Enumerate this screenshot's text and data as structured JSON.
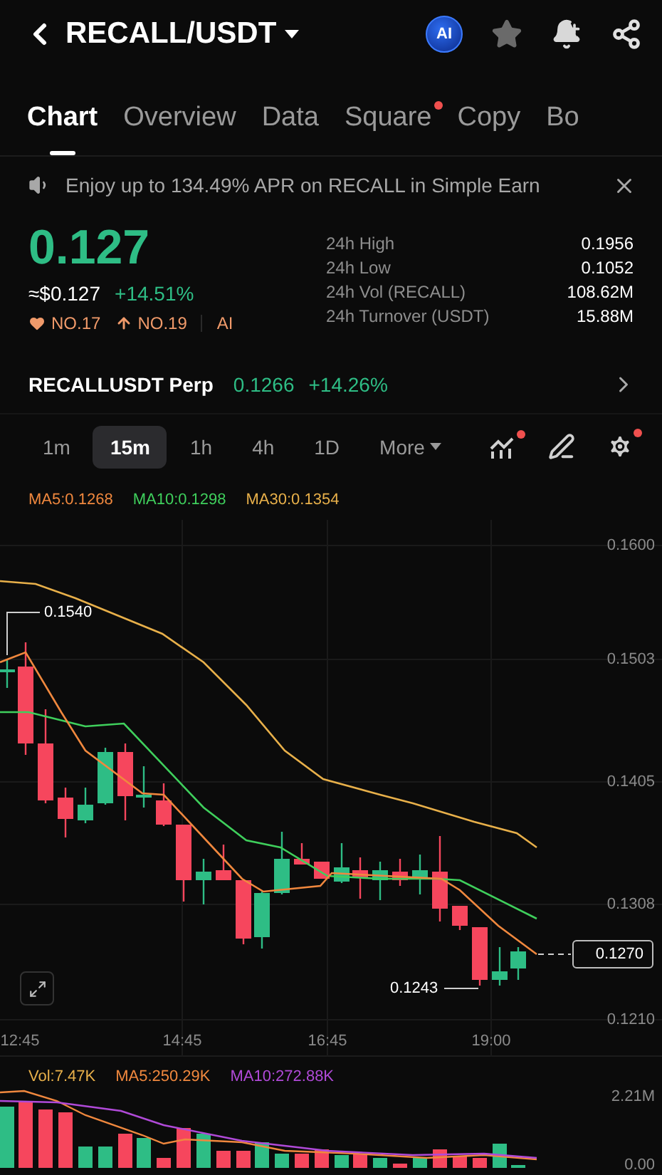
{
  "header": {
    "title": "RECALL/USDT",
    "ai_badge": "AI"
  },
  "tabs": [
    {
      "label": "Chart",
      "selected": true,
      "dot": false
    },
    {
      "label": "Overview",
      "selected": false,
      "dot": false
    },
    {
      "label": "Data",
      "selected": false,
      "dot": false
    },
    {
      "label": "Square",
      "selected": false,
      "dot": true
    },
    {
      "label": "Copy",
      "selected": false,
      "dot": false
    },
    {
      "label": "Bo",
      "selected": false,
      "dot": false
    }
  ],
  "banner": {
    "text": "Enjoy up to 134.49% APR on RECALL in Simple Earn"
  },
  "price": {
    "last": "0.127",
    "usd": "≈$0.127",
    "change": "+14.51%",
    "ranks": [
      {
        "kind": "hot",
        "label": "NO.17"
      },
      {
        "kind": "gainer",
        "label": "NO.19"
      }
    ],
    "ai": "AI"
  },
  "stats": [
    {
      "label": "24h High",
      "value": "0.1956"
    },
    {
      "label": "24h Low",
      "value": "0.1052"
    },
    {
      "label": "24h Vol (RECALL)",
      "value": "108.62M"
    },
    {
      "label": "24h Turnover (USDT)",
      "value": "15.88M"
    }
  ],
  "perp": {
    "name": "RECALLUSDT Perp",
    "price": "0.1266",
    "change": "+14.26%"
  },
  "intervals": [
    {
      "label": "1m",
      "selected": false
    },
    {
      "label": "15m",
      "selected": true
    },
    {
      "label": "1h",
      "selected": false
    },
    {
      "label": "4h",
      "selected": false
    },
    {
      "label": "1D",
      "selected": false
    }
  ],
  "more": "More",
  "tools": [
    {
      "kind": "indicator",
      "dot": true
    },
    {
      "kind": "draw",
      "dot": false
    },
    {
      "kind": "settings",
      "dot": true
    }
  ],
  "chart": {
    "ma_legend": [
      {
        "label": "MA5:0.1268",
        "color": "#f0883e"
      },
      {
        "label": "MA10:0.1298",
        "color": "#3fcf5c"
      },
      {
        "label": "MA30:0.1354",
        "color": "#e8b04a"
      }
    ],
    "y_ticks": [
      "0.1600",
      "0.1503",
      "0.1405",
      "0.1308",
      "0.1210"
    ],
    "x_ticks": [
      "12:45",
      "14:45",
      "16:45",
      "19:00"
    ],
    "high_marker": "0.1540",
    "low_marker": "0.1243",
    "last_price": "0.1270"
  },
  "volume": {
    "legend": [
      {
        "label": "Vol:7.47K",
        "color": "#e8b04a"
      },
      {
        "label": "MA5:250.29K",
        "color": "#f0883e"
      },
      {
        "label": "MA10:272.88K",
        "color": "#b04ad8"
      }
    ],
    "y_ticks": [
      "2.21M",
      "0.00"
    ]
  }
}
